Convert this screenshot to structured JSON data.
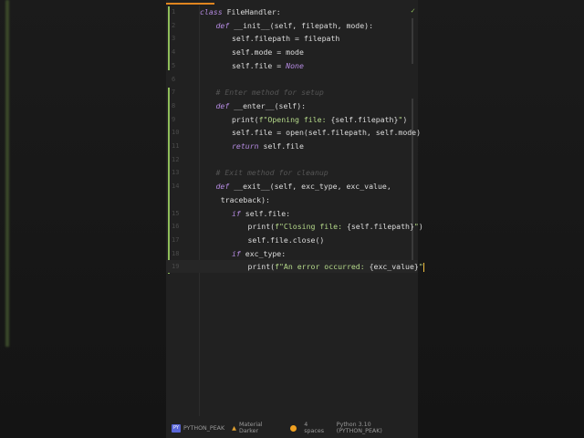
{
  "editor": {
    "lines": [
      {
        "n": "1",
        "indent": 0,
        "tokens": [
          [
            "kw",
            "class "
          ],
          [
            "t",
            "FileHandler:"
          ]
        ]
      },
      {
        "n": "2",
        "indent": 1,
        "tokens": [
          [
            "kw",
            "def "
          ],
          [
            "t",
            "__init__(self, filepath, mode):"
          ]
        ]
      },
      {
        "n": "3",
        "indent": 2,
        "tokens": [
          [
            "t",
            "self.filepath = filepath"
          ]
        ]
      },
      {
        "n": "4",
        "indent": 2,
        "tokens": [
          [
            "t",
            "self.mode = mode"
          ]
        ]
      },
      {
        "n": "5",
        "indent": 2,
        "tokens": [
          [
            "t",
            "self.file = "
          ],
          [
            "kw",
            "None"
          ]
        ]
      },
      {
        "n": "6",
        "indent": 0,
        "tokens": []
      },
      {
        "n": "7",
        "indent": 1,
        "tokens": [
          [
            "com",
            "# Enter method for setup"
          ]
        ]
      },
      {
        "n": "8",
        "indent": 1,
        "tokens": [
          [
            "kw",
            "def "
          ],
          [
            "t",
            "__enter__(self):"
          ]
        ]
      },
      {
        "n": "9",
        "indent": 2,
        "tokens": [
          [
            "t",
            "print("
          ],
          [
            "str",
            "f\"Opening file: "
          ],
          [
            "t",
            "{self.filepath}"
          ],
          [
            "str",
            "\""
          ],
          [
            "t",
            ")"
          ]
        ]
      },
      {
        "n": "10",
        "indent": 2,
        "tokens": [
          [
            "t",
            "self.file = open(self.filepath, self.mode)"
          ]
        ]
      },
      {
        "n": "11",
        "indent": 2,
        "tokens": [
          [
            "kw",
            "return "
          ],
          [
            "t",
            "self.file"
          ]
        ]
      },
      {
        "n": "12",
        "indent": 0,
        "tokens": []
      },
      {
        "n": "13",
        "indent": 1,
        "tokens": [
          [
            "com",
            "# Exit method for cleanup"
          ]
        ]
      },
      {
        "n": "14",
        "indent": 1,
        "tokens": [
          [
            "kw",
            "def "
          ],
          [
            "t",
            "__exit__(self, exc_type, exc_value,"
          ]
        ]
      },
      {
        "n": "",
        "indent": 1.3,
        "tokens": [
          [
            "t",
            "traceback):"
          ]
        ]
      },
      {
        "n": "15",
        "indent": 2,
        "tokens": [
          [
            "kw",
            "if "
          ],
          [
            "t",
            "self.file:"
          ]
        ]
      },
      {
        "n": "16",
        "indent": 3,
        "tokens": [
          [
            "t",
            "print("
          ],
          [
            "str",
            "f\"Closing file: "
          ],
          [
            "t",
            "{self.filepath}"
          ],
          [
            "str",
            "\""
          ],
          [
            "t",
            ")"
          ]
        ]
      },
      {
        "n": "17",
        "indent": 3,
        "tokens": [
          [
            "t",
            "self.file.close()"
          ]
        ]
      },
      {
        "n": "18",
        "indent": 2,
        "tokens": [
          [
            "kw",
            "if "
          ],
          [
            "t",
            "exc_type:"
          ]
        ]
      },
      {
        "n": "19",
        "indent": 3,
        "tokens": [
          [
            "t",
            "print("
          ],
          [
            "str",
            "f\"An error occurred: "
          ],
          [
            "t",
            "{exc_value}"
          ],
          [
            "str",
            "\""
          ]
        ],
        "current": true
      }
    ]
  },
  "status": {
    "project_icon": "PY",
    "project": "PYTHON_PEAK",
    "theme": "Material Darker",
    "indent": "4 spaces",
    "interpreter": "Python 3.10 (PYTHON_PEAK)"
  },
  "colors": {
    "accent": "#e0851f",
    "change": "#8fbd5a",
    "keyword": "#b48ae0",
    "string": "#b5d98a"
  }
}
